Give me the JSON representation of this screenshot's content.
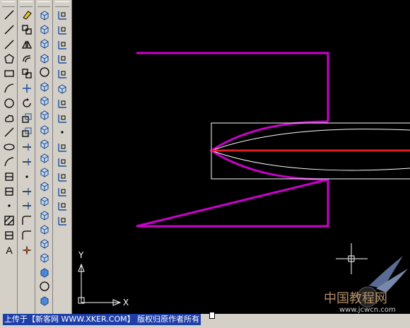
{
  "colors": {
    "canvas_bg": "#000000",
    "magenta_outline": "#cc00cc",
    "red_axis": "#e02020",
    "white_geometry": "#ffffff",
    "toolbar_bg": "#d4d0c8",
    "notice_bg": "#1e3ea8"
  },
  "toolbars": {
    "draw": [
      "line-icon",
      "construction-line-icon",
      "polyline-icon",
      "polygon-icon",
      "rectangle-icon",
      "arc-icon",
      "circle-icon",
      "revision-cloud-icon",
      "spline-icon",
      "ellipse-icon",
      "ellipse-arc-icon",
      "insert-block-icon",
      "make-block-icon",
      "point-icon",
      "hatch-icon",
      "region-icon",
      "text-icon"
    ],
    "modify": [
      "erase-icon",
      "copy-icon",
      "mirror-icon",
      "offset-icon",
      "array-icon",
      "move-icon",
      "rotate-icon",
      "scale-icon",
      "stretch-icon",
      "trim-icon",
      "extend-icon",
      "break-at-point-icon",
      "break-icon",
      "join-icon",
      "chamfer-icon",
      "fillet-icon",
      "explode-icon"
    ],
    "solids": [
      "view-top-icon",
      "box-icon",
      "wedge-icon",
      "cone-icon",
      "sphere-icon",
      "cylinder-icon",
      "torus-icon",
      "pyramid-icon",
      "extrude-icon",
      "revolve-icon",
      "slice-icon",
      "section-icon",
      "interfere-icon",
      "union-icon",
      "subtract-icon",
      "intersect-icon",
      "shell-icon",
      "cube-icon",
      "cube-blue-icon",
      "sphere-blue-icon",
      "cylinder-blue-icon"
    ],
    "ucs": [
      "ucs-icon",
      "ucs-world-icon",
      "ucs-previous-icon",
      "ucs-face-icon",
      "ucs-object-icon",
      "ucs-view-icon",
      "ucs-origin-icon",
      "ucs-zaxis-icon",
      "ucs-3point-icon",
      "ucs-x-icon",
      "ucs-y-icon",
      "ucs-z-icon",
      "ucs-apply-icon",
      "ucs-named-icon",
      "ucs-preset-icon"
    ]
  },
  "text_tool_label": "A",
  "ucs_icon": {
    "x_label": "X",
    "y_label": "Y"
  },
  "notice_text": "上传于【新客网 WWW.XKER.COM】 版权归原作者所有",
  "watermark": {
    "site_cn": "中国教程网",
    "site_url": "www.jcwcn.com"
  }
}
